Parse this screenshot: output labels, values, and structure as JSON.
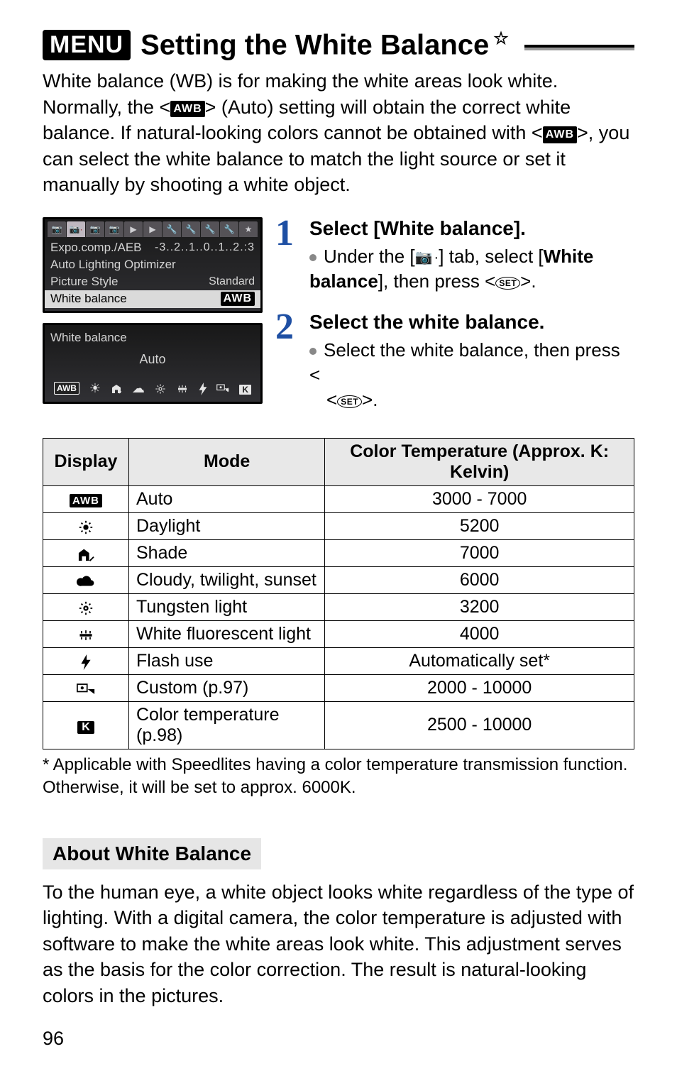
{
  "header": {
    "menu_badge": "MENU",
    "title": "Setting the White Balance",
    "star": "☆"
  },
  "intro": {
    "p1a": "White balance (WB) is for making the white areas look white. Normally, the <",
    "awb": "AWB",
    "p1b": "> (Auto) setting will obtain the correct white balance. If natural-looking colors cannot be obtained with <",
    "p1c": ">, you can select the white balance to match the light source or set it manually by shooting a white object."
  },
  "screens": {
    "s1": {
      "tabs": [
        "📷",
        "📷·",
        "📷··",
        "📷···",
        "▶",
        "▶·",
        "🔧",
        "🔧·",
        "🔧··",
        "🔧···",
        "★"
      ],
      "rows": [
        {
          "label": "Expo.comp./AEB",
          "value": "-3..2..1..0..1..2.:3"
        },
        {
          "label": "Auto Lighting Optimizer",
          "value": ""
        },
        {
          "label": "Picture Style",
          "value": "Standard"
        },
        {
          "label": "White balance",
          "value": "AWB",
          "selected": true
        }
      ]
    },
    "s2": {
      "title": "White balance",
      "center": "Auto",
      "icons": [
        "AWB",
        "☀",
        "⛱",
        "☁",
        "💡",
        "⬚",
        "⚡",
        "⬚◢",
        "K"
      ]
    }
  },
  "steps": {
    "s1": {
      "num": "1",
      "title": "Select [White balance].",
      "line_a": "Under the [",
      "cam_tab": "📷·",
      "line_b": "] tab, select [",
      "bold": "White balance",
      "line_c": "], then press <",
      "set": "SET",
      "line_d": ">."
    },
    "s2": {
      "num": "2",
      "title": "Select the white balance.",
      "line_a": "Select the white balance, then press <",
      "set": "SET",
      "line_b": ">."
    }
  },
  "table": {
    "h1": "Display",
    "h2": "Mode",
    "h3": "Color Temperature (Approx. K: Kelvin)",
    "rows": [
      {
        "disp": "AWB",
        "disp_type": "awb",
        "mode": "Auto",
        "temp": "3000 - 7000"
      },
      {
        "disp": "☀",
        "disp_type": "glyph",
        "mode": "Daylight",
        "temp": "5200"
      },
      {
        "disp": "shade",
        "disp_type": "shade",
        "mode": "Shade",
        "temp": "7000"
      },
      {
        "disp": "☁",
        "disp_type": "glyph",
        "mode": "Cloudy, twilight, sunset",
        "temp": "6000"
      },
      {
        "disp": "bulb",
        "disp_type": "bulb",
        "mode": "Tungsten light",
        "temp": "3200"
      },
      {
        "disp": "fluor",
        "disp_type": "fluor",
        "mode": "White fluorescent light",
        "temp": "4000"
      },
      {
        "disp": "⚡",
        "disp_type": "bolt",
        "mode": "Flash use",
        "temp": "Automatically set*"
      },
      {
        "disp": "custom",
        "disp_type": "custom",
        "mode": "Custom (p.97)",
        "temp": "2000 - 10000"
      },
      {
        "disp": "K",
        "disp_type": "k",
        "mode": "Color temperature (p.98)",
        "temp": "2500 - 10000"
      }
    ]
  },
  "footnote": {
    "a": "* Applicable with Speedlites having a color temperature transmission function. Otherwise, it will be set to approx. 6000K."
  },
  "about": {
    "heading": "About White Balance",
    "body": "To the human eye, a white object looks white regardless of the type of lighting. With a digital camera, the color temperature is adjusted with software to make the white areas look white. This adjustment serves as the basis for the color correction. The result is natural-looking colors in the pictures."
  },
  "page_number": "96"
}
